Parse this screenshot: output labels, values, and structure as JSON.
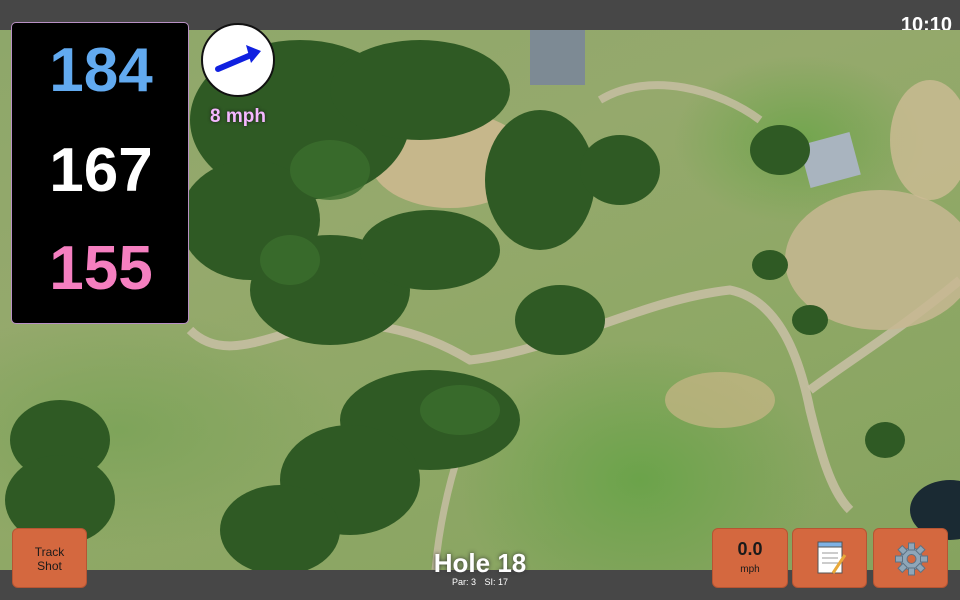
{
  "status": {
    "time": "10:10"
  },
  "distances": {
    "back": "184",
    "middle": "167",
    "front": "155"
  },
  "wind": {
    "speed": "8 mph",
    "direction_icon": "wind-arrow-icon",
    "arrow_color": "#1020e0"
  },
  "hole": {
    "title": "Hole 18",
    "par_label": "Par: 3",
    "si_label": "SI: 17"
  },
  "buttons": {
    "track_shot_line1": "Track",
    "track_shot_line2": "Shot",
    "speed_value": "0.0",
    "speed_unit": "mph",
    "notes_icon": "notepad-icon",
    "settings_icon": "gear-icon"
  },
  "colors": {
    "back_distance": "#62aaf0",
    "middle_distance": "#ffffff",
    "front_distance": "#f57fc0",
    "button_bg": "#d4683f"
  }
}
